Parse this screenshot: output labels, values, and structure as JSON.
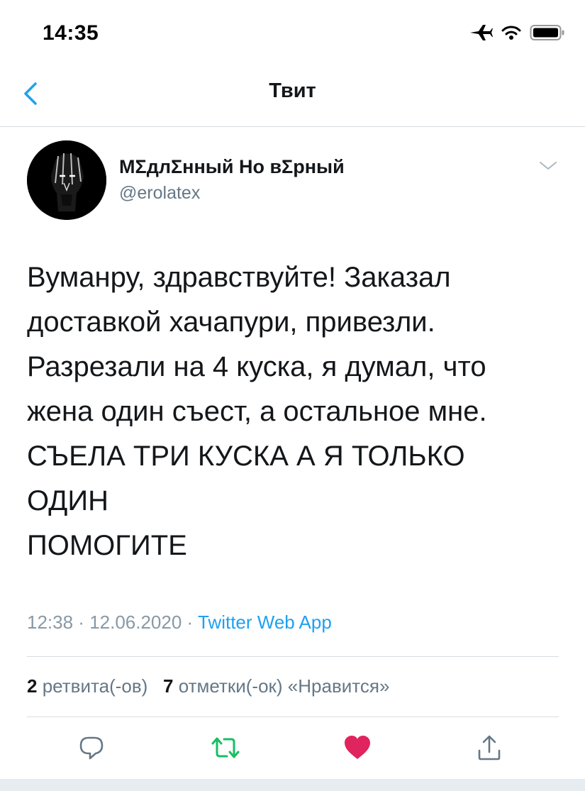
{
  "status_bar": {
    "time": "14:35",
    "icons": [
      "airplane-icon",
      "wifi-icon",
      "battery-icon"
    ]
  },
  "nav": {
    "title": "Твит",
    "back_icon": "chevron-left-icon"
  },
  "tweet": {
    "author": {
      "name": "MΣдлΣнный Но вΣрный",
      "handle": "@erolatex"
    },
    "text_lines": [
      "Вуманру, здравствуйте! Заказал",
      "доставкой хачапури, привезли.",
      "Разрезали на 4 куска, я думал, что",
      "жена один съест, а остальное мне.",
      "СЪЕЛА ТРИ КУСКА А Я ТОЛЬКО",
      "ОДИН",
      "ПОМОГИТЕ"
    ],
    "time": "12:38",
    "date": "12.06.2020",
    "separator": " · ",
    "source": "Twitter Web App",
    "retweets_count": "2",
    "retweets_label": "ретвита(-ов)",
    "likes_count": "7",
    "likes_label": "отметки(-ок) «Нравится»"
  },
  "actions": [
    "reply-icon",
    "retweet-icon",
    "like-icon",
    "share-icon"
  ],
  "colors": {
    "accent": "#1da1f2",
    "retweet": "#17bf63",
    "like": "#e0245e",
    "secondary_text": "#657786",
    "meta_text": "#8899a6",
    "divider": "#d9dde0"
  }
}
